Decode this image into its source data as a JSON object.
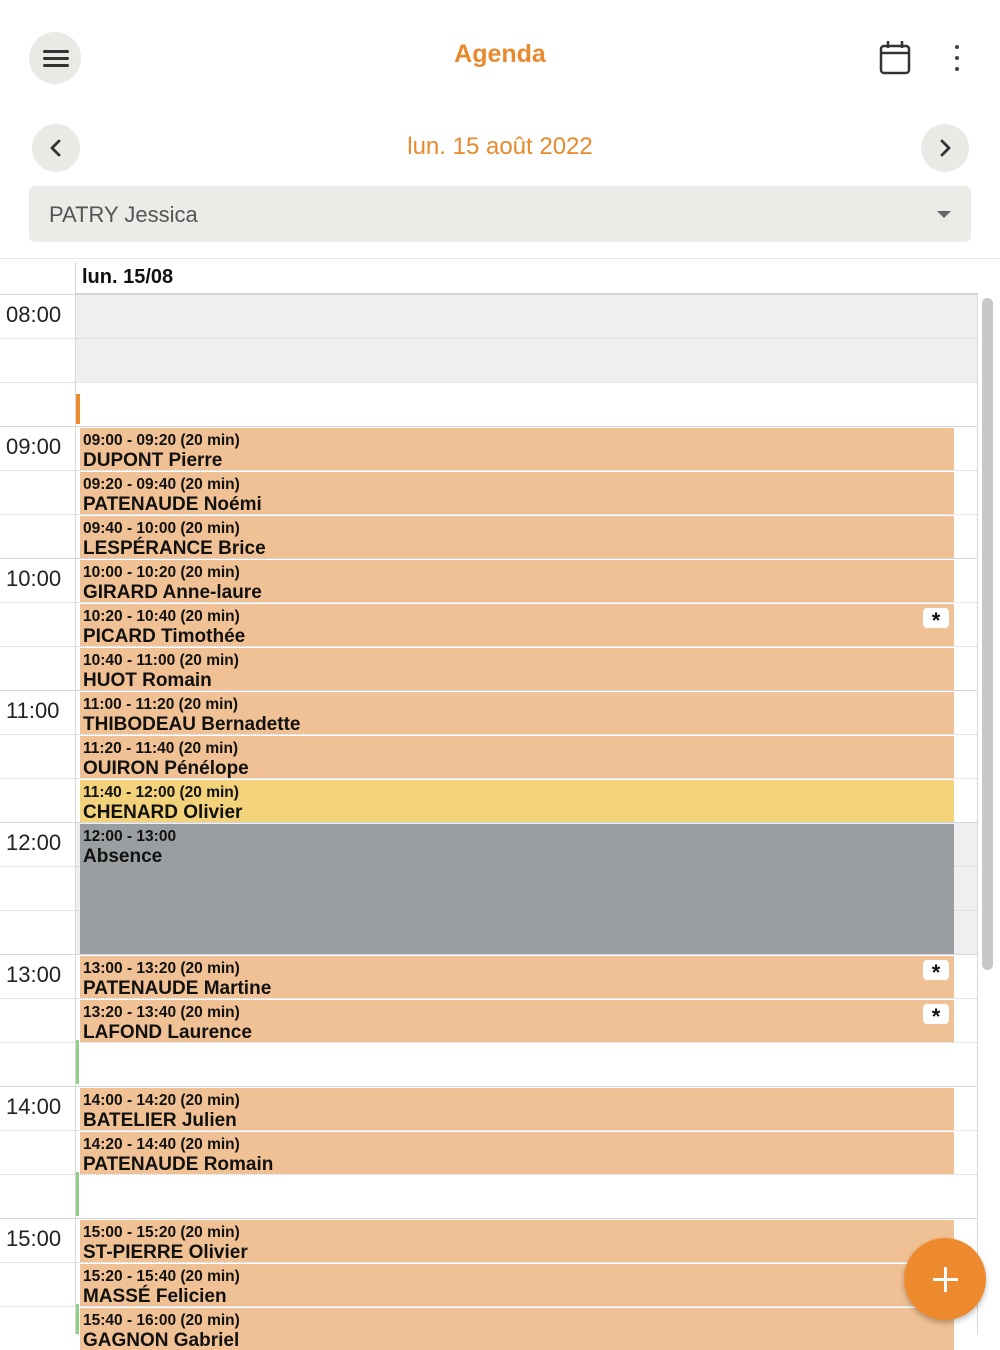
{
  "header": {
    "title": "Agenda",
    "menu_icon": "hamburger-menu-icon",
    "calendar_icon": "calendar-icon",
    "more_icon": "more-vertical-icon"
  },
  "date_nav": {
    "current_date": "lun. 15 août 2022",
    "prev_icon": "chevron-left-icon",
    "next_icon": "chevron-right-icon"
  },
  "practitioner_select": {
    "value": "PATRY Jessica"
  },
  "calendar": {
    "day_label": "lun. 15/08",
    "hours": [
      "08:00",
      "09:00",
      "10:00",
      "11:00",
      "12:00",
      "13:00",
      "14:00",
      "15:00"
    ],
    "appointments": [
      {
        "time": "09:00 - 09:20 (20 min)",
        "name": "DUPONT Pierre",
        "flag": ""
      },
      {
        "time": "09:20 - 09:40 (20 min)",
        "name": "PATENAUDE Noémi",
        "flag": ""
      },
      {
        "time": "09:40 - 10:00 (20 min)",
        "name": "LESPÉRANCE Brice",
        "flag": ""
      },
      {
        "time": "10:00 - 10:20 (20 min)",
        "name": "GIRARD Anne-laure",
        "flag": ""
      },
      {
        "time": "10:20 - 10:40 (20 min)",
        "name": "PICARD Timothée",
        "flag": "*"
      },
      {
        "time": "10:40 - 11:00 (20 min)",
        "name": "HUOT Romain",
        "flag": ""
      },
      {
        "time": "11:00 - 11:20 (20 min)",
        "name": "THIBODEAU Bernadette",
        "flag": ""
      },
      {
        "time": "11:20 - 11:40 (20 min)",
        "name": "OUIRON Pénélope",
        "flag": ""
      },
      {
        "time": "11:40 - 12:00 (20 min)",
        "name": "CHENARD Olivier",
        "flag": ""
      },
      {
        "time": "12:00 - 13:00",
        "name": "Absence",
        "flag": ""
      },
      {
        "time": "13:00 - 13:20 (20 min)",
        "name": "PATENAUDE Martine",
        "flag": "*"
      },
      {
        "time": "13:20 - 13:40 (20 min)",
        "name": "LAFOND Laurence",
        "flag": "*"
      },
      {
        "time": "14:00 - 14:20 (20 min)",
        "name": "BATELIER Julien",
        "flag": ""
      },
      {
        "time": "14:20 - 14:40 (20 min)",
        "name": "PATENAUDE Romain",
        "flag": ""
      },
      {
        "time": "15:00 - 15:20 (20 min)",
        "name": "ST-PIERRE Olivier",
        "flag": ""
      },
      {
        "time": "15:20 - 15:40 (20 min)",
        "name": "MASSÉ Felicien",
        "flag": ""
      },
      {
        "time": "15:40 - 16:00 (20 min)",
        "name": "GAGNON Gabriel",
        "flag": ""
      }
    ]
  },
  "colors": {
    "accent": "#e8892e",
    "appointment": "#f0c194",
    "appointment_highlight": "#f2d27a",
    "absence": "#9a9ea1",
    "unavailable": "#eeeff1"
  },
  "fab": {
    "icon": "plus-icon"
  }
}
